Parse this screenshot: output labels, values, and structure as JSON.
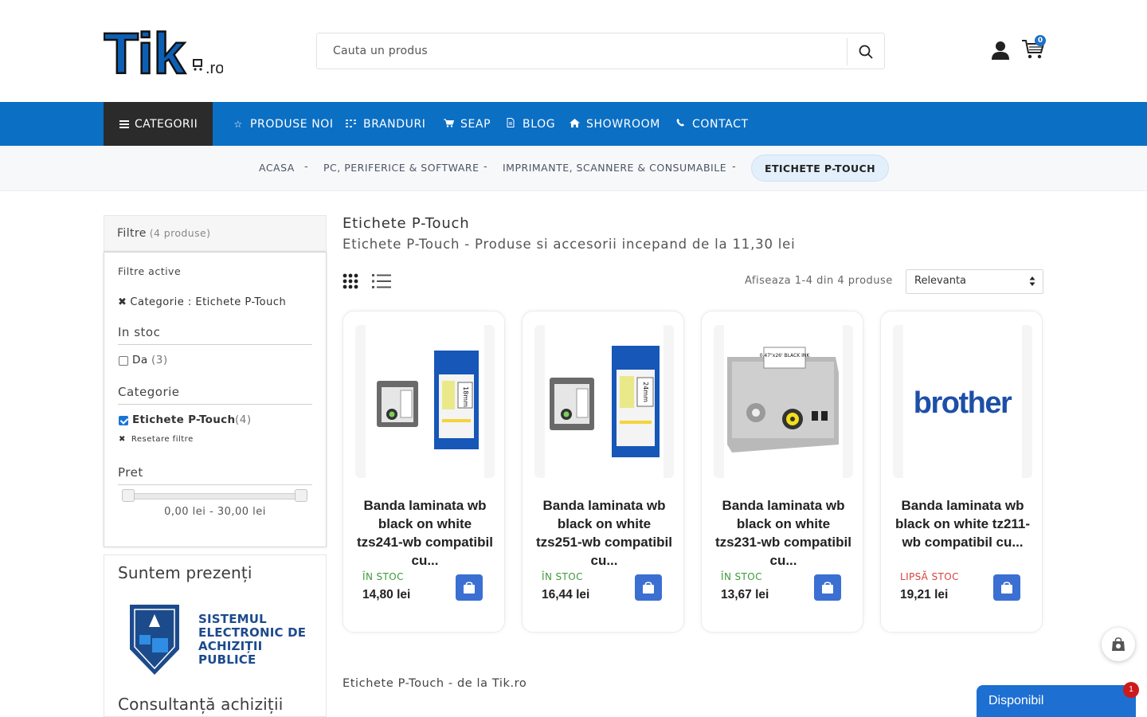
{
  "header": {
    "logo_main": "Tik",
    "logo_suffix": ".ro",
    "search_placeholder": "Cauta un produs",
    "cart_count": "0"
  },
  "nav": {
    "categories_label": "CATEGORII",
    "items": [
      {
        "label": "PRODUSE NOI",
        "icon": "star-icon"
      },
      {
        "label": "BRANDURI",
        "icon": "grid-icon"
      },
      {
        "label": "SEAP",
        "icon": "cart-icon"
      },
      {
        "label": "BLOG",
        "icon": "document-icon"
      },
      {
        "label": "SHOWROOM",
        "icon": "home-icon"
      },
      {
        "label": "CONTACT",
        "icon": "phone-icon"
      }
    ]
  },
  "breadcrumb": {
    "items": [
      "ACASA",
      "PC, PERIFERICE & SOFTWARE",
      "IMPRIMANTE, SCANNERE & CONSUMABILE"
    ],
    "separator": "-",
    "current": "ETICHETE P-TOUCH"
  },
  "filters": {
    "title": "Filtre",
    "count": "(4 produse)",
    "active_title": "Filtre active",
    "active_item": "Categorie : Etichete P-Touch",
    "stock_title": "In stoc",
    "stock_option": {
      "label": "Da",
      "count": "(3)",
      "checked": false
    },
    "category_title": "Categorie",
    "category_option": {
      "label": "Etichete P-Touch",
      "count": "(4)",
      "checked": true
    },
    "reset_label": "Resetare filtre",
    "price_title": "Pret",
    "price_range": "0,00 lei - 30,00 lei"
  },
  "promo": {
    "title": "Suntem prezenți",
    "seap_text": "SISTEMUL ELECTRONIC DE ACHIZIȚII PUBLICE",
    "title2": "Consultanță achiziții"
  },
  "main": {
    "title": "Etichete P-Touch",
    "subtitle": "Etichete P-Touch - Produse si accesorii incepand de la 11,30 lei",
    "result_count": "Afiseaza 1-4 din 4 produse",
    "sort_value": "Relevanta",
    "bottom_text": "Etichete P-Touch - de la Tik.ro"
  },
  "products": [
    {
      "name": "Banda laminata wb black on white tzs241-wb compatibil cu...",
      "stock": "ÎN STOC",
      "stock_color": "#3c9a3c",
      "price": "14,80 lei",
      "image": "tape-18mm",
      "tape_label": "18mm"
    },
    {
      "name": "Banda laminata wb black on white tzs251-wb compatibil cu...",
      "stock": "ÎN STOC",
      "stock_color": "#3c9a3c",
      "price": "16,44 lei",
      "image": "tape-24mm",
      "tape_label": "24mm"
    },
    {
      "name": "Banda laminata wb black on white tzs231-wb compatibil cu...",
      "stock": "ÎN STOC",
      "stock_color": "#3c9a3c",
      "price": "13,67 lei",
      "image": "tape-cassette",
      "tape_label": "0.47\"x26' BLACK INK"
    },
    {
      "name": "Banda laminata wb black on white tz211-wb compatibil cu...",
      "stock": "LIPSĂ STOC",
      "stock_color": "#d9413c",
      "price": "19,21 lei",
      "image": "brother-logo",
      "tape_label": "brother"
    }
  ],
  "chat": {
    "label": "Disponibil",
    "badge": "1"
  },
  "colors": {
    "nav_blue": "#0b6fc4",
    "dark": "#2b2b2b",
    "accent_button": "#3b6fd2"
  }
}
